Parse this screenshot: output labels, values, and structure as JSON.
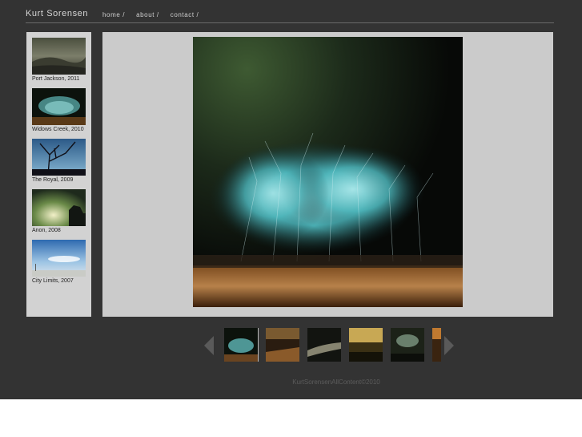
{
  "site": {
    "title": "Kurt Sorensen"
  },
  "nav": [
    {
      "label": "home /"
    },
    {
      "label": "about /"
    },
    {
      "label": "contact /"
    }
  ],
  "galleries": [
    {
      "caption": "Port Jackson, 2011"
    },
    {
      "caption": "Widows Creek, 2010"
    },
    {
      "caption": "The Royal, 2009"
    },
    {
      "caption": "Anon, 2008"
    },
    {
      "caption": "City Limits, 2007"
    }
  ],
  "filmstrip": {
    "count_visible": 6,
    "selected": 1
  },
  "footer": {
    "text": "KurtSorensenAllContent©2010"
  }
}
